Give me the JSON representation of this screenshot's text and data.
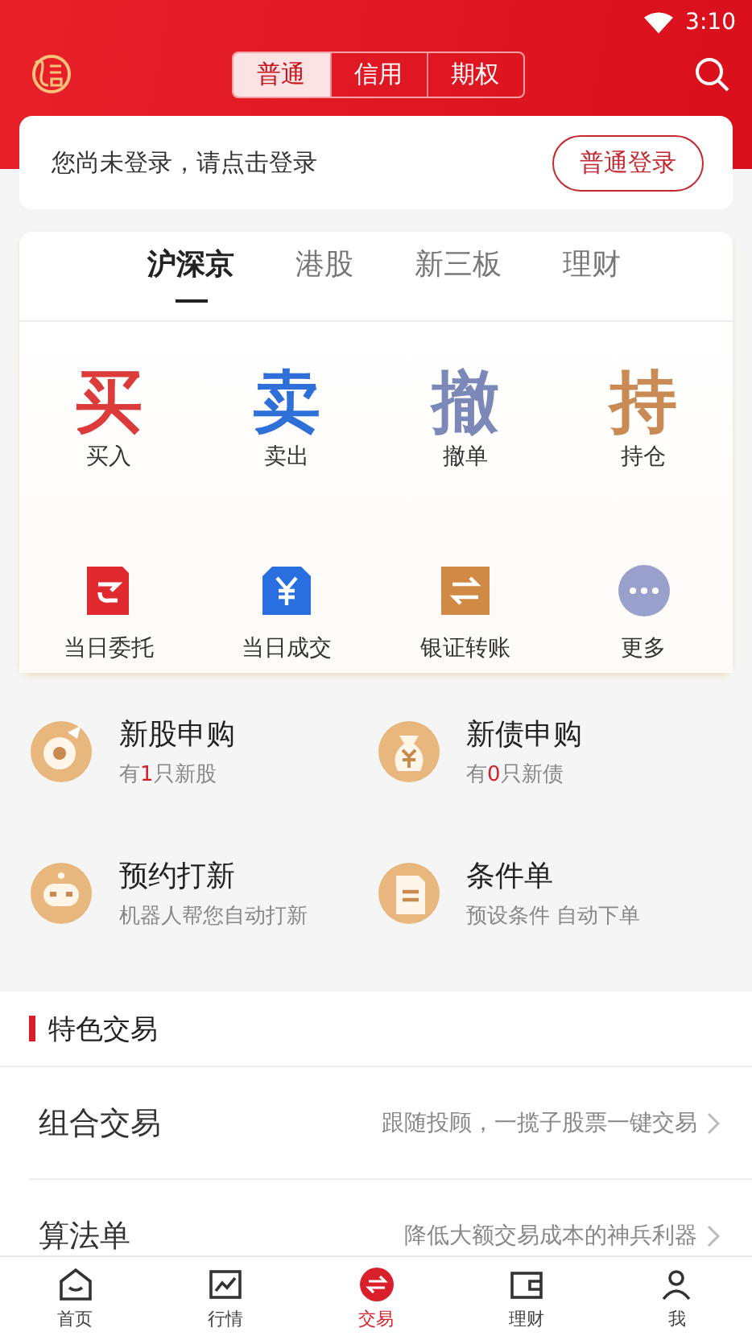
{
  "status_bar": {
    "time": "3:10"
  },
  "header": {
    "tabs": [
      {
        "label": "普通",
        "selected": true
      },
      {
        "label": "信用",
        "selected": false
      },
      {
        "label": "期权",
        "selected": false
      }
    ]
  },
  "login_card": {
    "message": "您尚未登录，请点击登录",
    "button": "普通登录"
  },
  "market_tabs": [
    {
      "label": "沪深京",
      "selected": true
    },
    {
      "label": "港股",
      "selected": false
    },
    {
      "label": "新三板",
      "selected": false
    },
    {
      "label": "理财",
      "selected": false
    }
  ],
  "trade_actions": [
    {
      "glyph": "买",
      "label": "买入",
      "color": "#dc3b3b"
    },
    {
      "glyph": "卖",
      "label": "卖出",
      "color": "#2f6fd8"
    },
    {
      "glyph": "撤",
      "label": "撤单",
      "color": "#7c89b8"
    },
    {
      "glyph": "持",
      "label": "持仓",
      "color": "#c98a55"
    }
  ],
  "quick_actions": [
    {
      "kind": "entrust",
      "label": "当日委托"
    },
    {
      "kind": "deal",
      "label": "当日成交"
    },
    {
      "kind": "transfer",
      "label": "银证转账"
    },
    {
      "kind": "more",
      "label": "更多"
    }
  ],
  "features": [
    {
      "kind": "ipo",
      "title": "新股申购",
      "prefix": "有",
      "count": "1",
      "suffix": "只新股"
    },
    {
      "kind": "bond",
      "title": "新债申购",
      "prefix": "有",
      "count": "0",
      "suffix": "只新债"
    },
    {
      "kind": "robot",
      "title": "预约打新",
      "subtitle": "机器人帮您自动打新"
    },
    {
      "kind": "condition",
      "title": "条件单",
      "subtitle": "预设条件 自动下单"
    }
  ],
  "special_trading": {
    "title": "特色交易",
    "rows": [
      {
        "title": "组合交易",
        "description": "跟随投顾，一揽子股票一键交易"
      },
      {
        "title": "算法单",
        "description": "降低大额交易成本的神兵利器"
      }
    ]
  },
  "bottom_nav": [
    {
      "kind": "home",
      "label": "首页",
      "selected": false
    },
    {
      "kind": "chart",
      "label": "行情",
      "selected": false
    },
    {
      "kind": "trade",
      "label": "交易",
      "selected": true
    },
    {
      "kind": "wallet",
      "label": "理财",
      "selected": false
    },
    {
      "kind": "person",
      "label": "我",
      "selected": false
    }
  ]
}
